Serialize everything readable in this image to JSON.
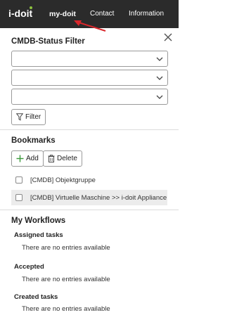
{
  "header": {
    "logo": "i-doit",
    "nav": [
      {
        "label": "my-doit",
        "active": true
      },
      {
        "label": "Contact",
        "active": false
      },
      {
        "label": "Information",
        "active": false
      }
    ]
  },
  "status_filter": {
    "title": "CMDB-Status Filter",
    "selects": [
      "",
      "",
      ""
    ],
    "filter_button": "Filter"
  },
  "bookmarks": {
    "title": "Bookmarks",
    "add_button": "Add",
    "delete_button": "Delete",
    "items": [
      {
        "label": "[CMDB] Objektgruppe",
        "highlighted": false
      },
      {
        "label": "[CMDB] Virtuelle Maschine >> i-doit Appliance",
        "highlighted": true
      }
    ]
  },
  "workflows": {
    "title": "My Workflows",
    "groups": [
      {
        "title": "Assigned tasks",
        "empty": "There are no entries available"
      },
      {
        "title": "Accepted",
        "empty": "There are no entries available"
      },
      {
        "title": "Created tasks",
        "empty": "There are no entries available"
      }
    ]
  },
  "colors": {
    "topbar": "#2b2b2b",
    "logo_accent": "#8ec23f",
    "annotation_arrow": "#d9262b",
    "add_icon": "#3a9a3a"
  },
  "icons": [
    "close-icon",
    "chevron-down-icon",
    "funnel-icon",
    "plus-icon",
    "trash-icon"
  ]
}
